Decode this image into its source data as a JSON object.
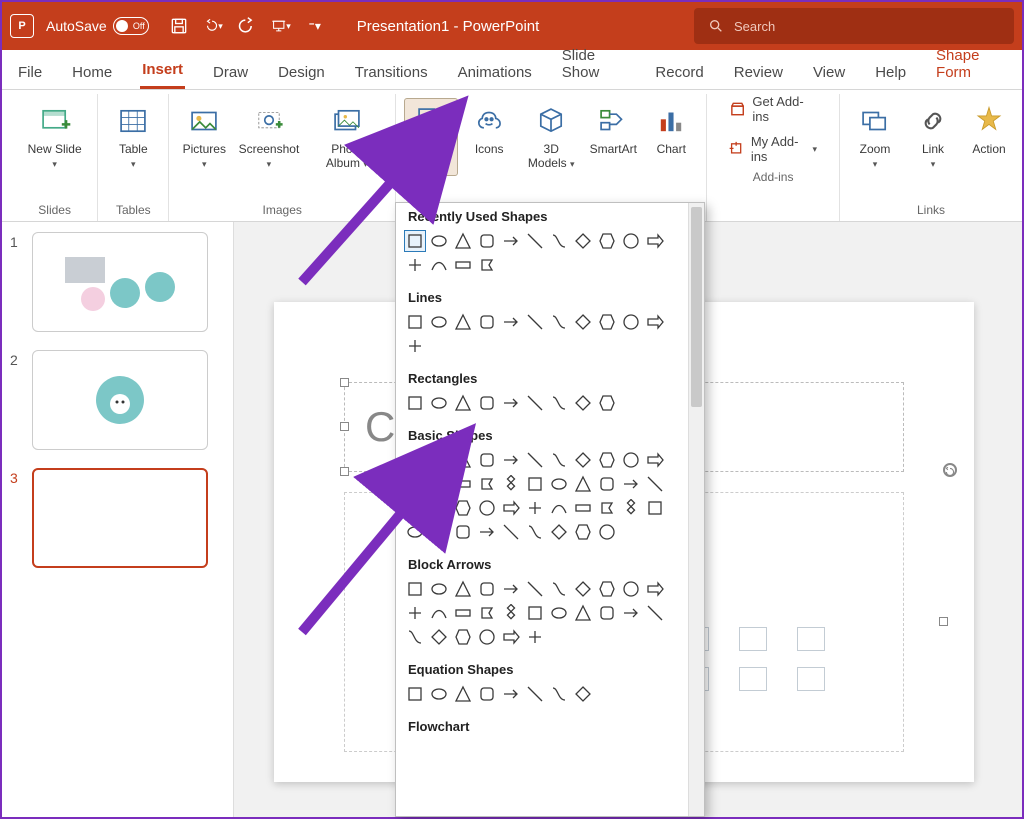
{
  "titlebar": {
    "autosave_label": "AutoSave",
    "autosave_state": "Off",
    "title": "Presentation1  -  PowerPoint",
    "search_placeholder": "Search"
  },
  "tabs": [
    "File",
    "Home",
    "Insert",
    "Draw",
    "Design",
    "Transitions",
    "Animations",
    "Slide Show",
    "Record",
    "Review",
    "View",
    "Help",
    "Shape Form"
  ],
  "active_tab": "Insert",
  "ribbon": {
    "slides": {
      "new_slide": "New Slide",
      "group": "Slides"
    },
    "tables": {
      "table": "Table",
      "group": "Tables"
    },
    "images": {
      "pictures": "Pictures",
      "screenshot": "Screenshot",
      "photo_album": "Photo Album",
      "group": "Images"
    },
    "illustrations": {
      "shapes": "Shapes",
      "icons": "Icons",
      "models": "3D Models",
      "smartart": "SmartArt",
      "chart": "Chart"
    },
    "addins": {
      "get": "Get Add-ins",
      "my": "My Add-ins",
      "group": "Add-ins"
    },
    "links": {
      "zoom": "Zoom",
      "link": "Link",
      "action": "Action",
      "group": "Links"
    }
  },
  "shapes_menu": {
    "categories": [
      "Recently Used Shapes",
      "Lines",
      "Rectangles",
      "Basic Shapes",
      "Block Arrows",
      "Equation Shapes",
      "Flowchart"
    ],
    "counts": {
      "Recently Used Shapes": 15,
      "Lines": 12,
      "Rectangles": 9,
      "Basic Shapes": 42,
      "Block Arrows": 28,
      "Equation Shapes": 8,
      "Flowchart": 0
    }
  },
  "slides": [
    {
      "num": "1"
    },
    {
      "num": "2"
    },
    {
      "num": "3"
    }
  ],
  "selected_slide": 3,
  "title_placeholder": "Cl"
}
